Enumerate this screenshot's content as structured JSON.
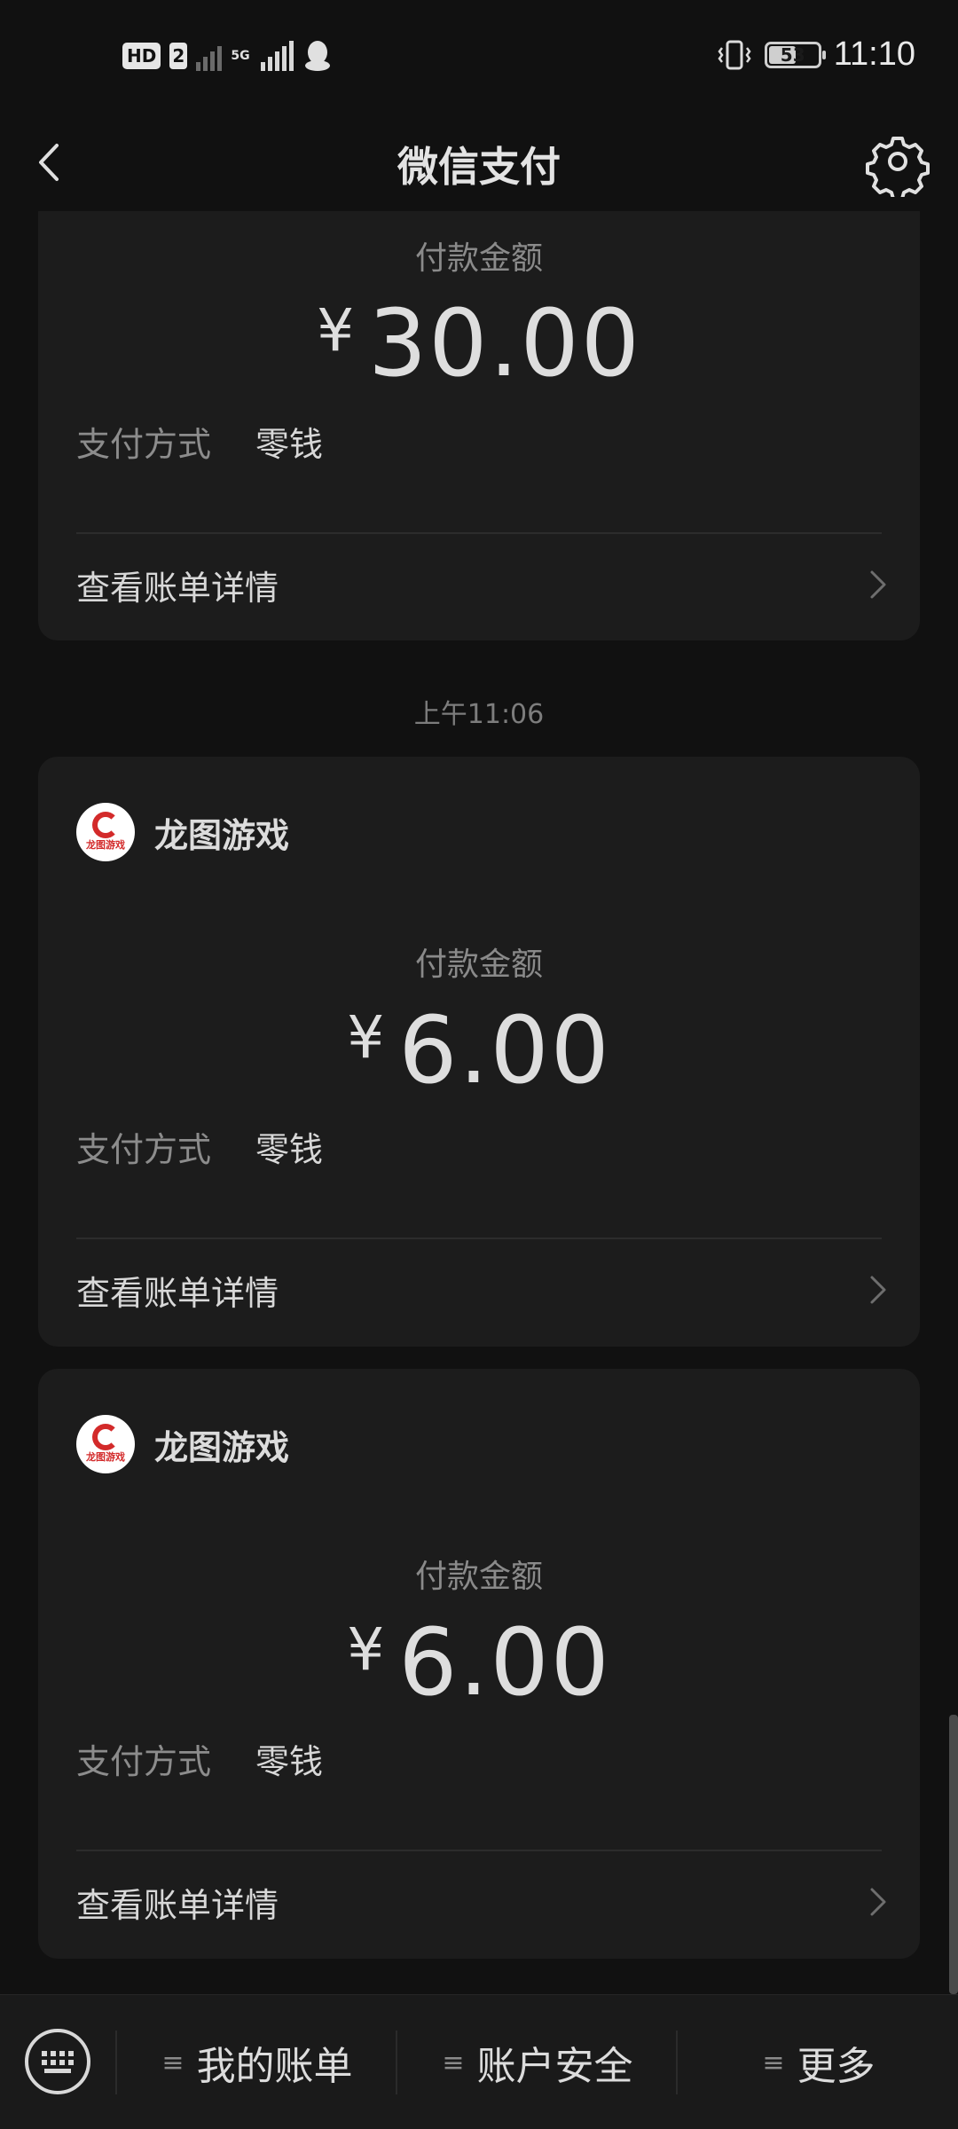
{
  "status_bar": {
    "hd": "HD",
    "sim": "2",
    "net": "5G",
    "battery": "53",
    "time": "11:10"
  },
  "header": {
    "title": "微信支付"
  },
  "cards": [
    {
      "amount_label": "付款金额",
      "currency": "¥",
      "amount": "30.00",
      "pay_method_label": "支付方式",
      "pay_method": "零钱",
      "detail_label": "查看账单详情"
    },
    {
      "merchant": "龙图游戏",
      "logo_text": "龙图游戏",
      "amount_label": "付款金额",
      "currency": "¥",
      "amount": "6.00",
      "pay_method_label": "支付方式",
      "pay_method": "零钱",
      "detail_label": "查看账单详情"
    },
    {
      "merchant": "龙图游戏",
      "logo_text": "龙图游戏",
      "amount_label": "付款金额",
      "currency": "¥",
      "amount": "6.00",
      "pay_method_label": "支付方式",
      "pay_method": "零钱",
      "detail_label": "查看账单详情"
    }
  ],
  "timestamp": "上午11:06",
  "bottom_menu": {
    "items": [
      "我的账单",
      "账户安全",
      "更多"
    ],
    "menu_glyph": "≡"
  },
  "colors": {
    "background": "#111111",
    "card": "#1c1c1c",
    "logo_red": "#d32a2a"
  }
}
